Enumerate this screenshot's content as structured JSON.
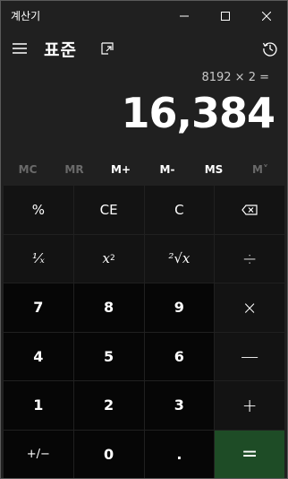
{
  "window": {
    "title": "계산기",
    "controls": {
      "minimize": "–",
      "maximize": "☐",
      "close": "✕"
    }
  },
  "header": {
    "mode": "표준"
  },
  "display": {
    "expression": "8192 × 2 =",
    "result": "16,384"
  },
  "memory": [
    {
      "label": "MC",
      "enabled": false
    },
    {
      "label": "MR",
      "enabled": false
    },
    {
      "label": "M+",
      "enabled": true
    },
    {
      "label": "M-",
      "enabled": true
    },
    {
      "label": "MS",
      "enabled": true
    },
    {
      "label": "M˅",
      "enabled": false
    }
  ],
  "keys": {
    "percent": "%",
    "clear_entry": "CE",
    "clear": "C",
    "backspace": "⌫",
    "reciprocal": "¹⁄ₓ",
    "square_base": "x",
    "square_exp": "2",
    "sqrt": "²√x",
    "divide": "÷",
    "seven": "7",
    "eight": "8",
    "nine": "9",
    "multiply": "×",
    "four": "4",
    "five": "5",
    "six": "6",
    "minus": "—",
    "one": "1",
    "two": "2",
    "three": "3",
    "plus": "+",
    "negate": "+/−",
    "zero": "0",
    "decimal": ".",
    "equals": "="
  },
  "colors": {
    "background": "#202020",
    "key_function": "#131313",
    "key_number": "#060606",
    "key_equals": "#1e4c26"
  }
}
